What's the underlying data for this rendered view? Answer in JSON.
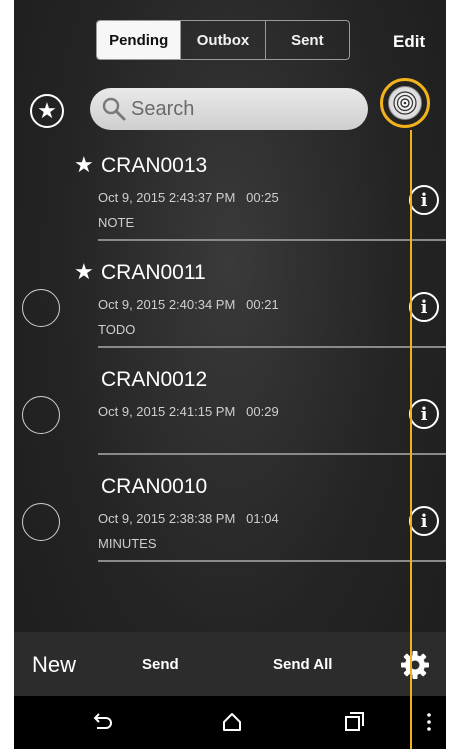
{
  "tabs": [
    {
      "label": "Pending",
      "active": true
    },
    {
      "label": "Outbox",
      "active": false
    },
    {
      "label": "Sent",
      "active": false
    }
  ],
  "header": {
    "edit_label": "Edit"
  },
  "search": {
    "placeholder": "Search"
  },
  "recordings": [
    {
      "name": "CRAN0013",
      "starred": true,
      "show_checkbox": false,
      "datetime": "Oct 9, 2015 2:43:37 PM",
      "duration": "00:25",
      "category": "NOTE"
    },
    {
      "name": "CRAN0011",
      "starred": true,
      "show_checkbox": true,
      "datetime": "Oct 9, 2015 2:40:34 PM",
      "duration": "00:21",
      "category": "TODO"
    },
    {
      "name": "CRAN0012",
      "starred": false,
      "show_checkbox": true,
      "datetime": "Oct 9, 2015 2:41:15 PM",
      "duration": "00:29",
      "category": ""
    },
    {
      "name": "CRAN0010",
      "starred": false,
      "show_checkbox": true,
      "datetime": "Oct 9, 2015 2:38:38 PM",
      "duration": "01:04",
      "category": "MINUTES"
    }
  ],
  "toolbar": {
    "new_label": "New",
    "send_label": "Send",
    "send_all_label": "Send All"
  },
  "icons": {
    "filter": "star-icon",
    "dictate": "dictate-icon",
    "info": "info-icon",
    "settings": "gear-icon"
  },
  "colors": {
    "highlight": "#f2b21b",
    "background": "#242424"
  }
}
